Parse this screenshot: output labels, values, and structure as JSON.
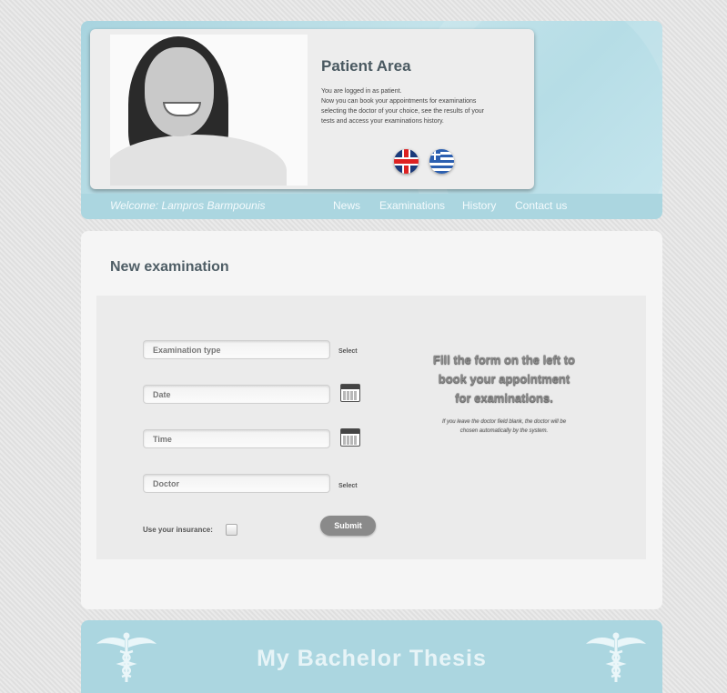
{
  "header": {
    "title": "Patient Area",
    "info_lines": [
      "You are logged in as patient.",
      "Now you can book your appointments for examinations",
      "selecting the doctor of your choice, see the results of your",
      "tests and access your examinations history."
    ],
    "welcome": "Welcome: Lampros Barmpounis",
    "nav": [
      "News",
      "Examinations",
      "History",
      "Contact us"
    ],
    "languages": [
      "english-flag-icon",
      "greek-flag-icon"
    ]
  },
  "main": {
    "title": "New examination",
    "fields": {
      "examination_type": "Examination type",
      "date": "Date",
      "time": "Time",
      "doctor": "Doctor"
    },
    "select_label": "Select",
    "insurance_label": "Use your insurance:",
    "submit_label": "Submit",
    "hint_lines": [
      "Fill the form on the left to",
      "book your appointment",
      "for examinations."
    ],
    "hint_small_lines": [
      "If you leave the doctor field blank, the doctor will be",
      "chosen automatically by the system."
    ]
  },
  "footer": {
    "title": "My Bachelor Thesis"
  },
  "colors": {
    "header_bg": "#abd6e0",
    "panel_bg": "#f5f5f5",
    "title_text": "#4f5e66"
  }
}
